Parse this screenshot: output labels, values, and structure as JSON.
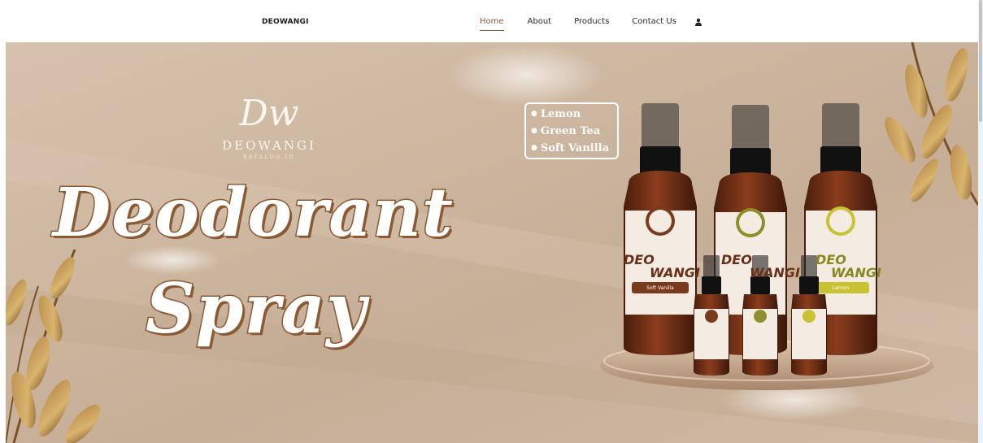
{
  "navbar": {
    "brand": "DEOWANGI",
    "items": [
      {
        "label": "Home",
        "active": true
      },
      {
        "label": "About",
        "active": false
      },
      {
        "label": "Products",
        "active": false
      },
      {
        "label": "Contact Us",
        "active": false
      }
    ],
    "user_icon": "user-icon"
  },
  "hero": {
    "logo_script": "Dw",
    "logo_name": "DEOWANGI",
    "logo_sub": "KATALOG.ID",
    "headline_line1": "Deodorant",
    "headline_line2": "Spray",
    "variants": [
      "Lemon",
      "Green Tea",
      "Soft Vanilla"
    ],
    "bottle_brand": "DEO",
    "bottle_brand2": "WANGI",
    "bottle_flavors": [
      "Soft Vanilla",
      "Green Tea",
      "Lemon"
    ]
  },
  "colors": {
    "accent": "#8a5a3a",
    "hero_bg": "#cdb7a0",
    "bottle_brown": "#6b2e16",
    "label_cream": "#f4ece2",
    "label_green": "#8d8f2a",
    "label_yellow": "#c9c232"
  }
}
